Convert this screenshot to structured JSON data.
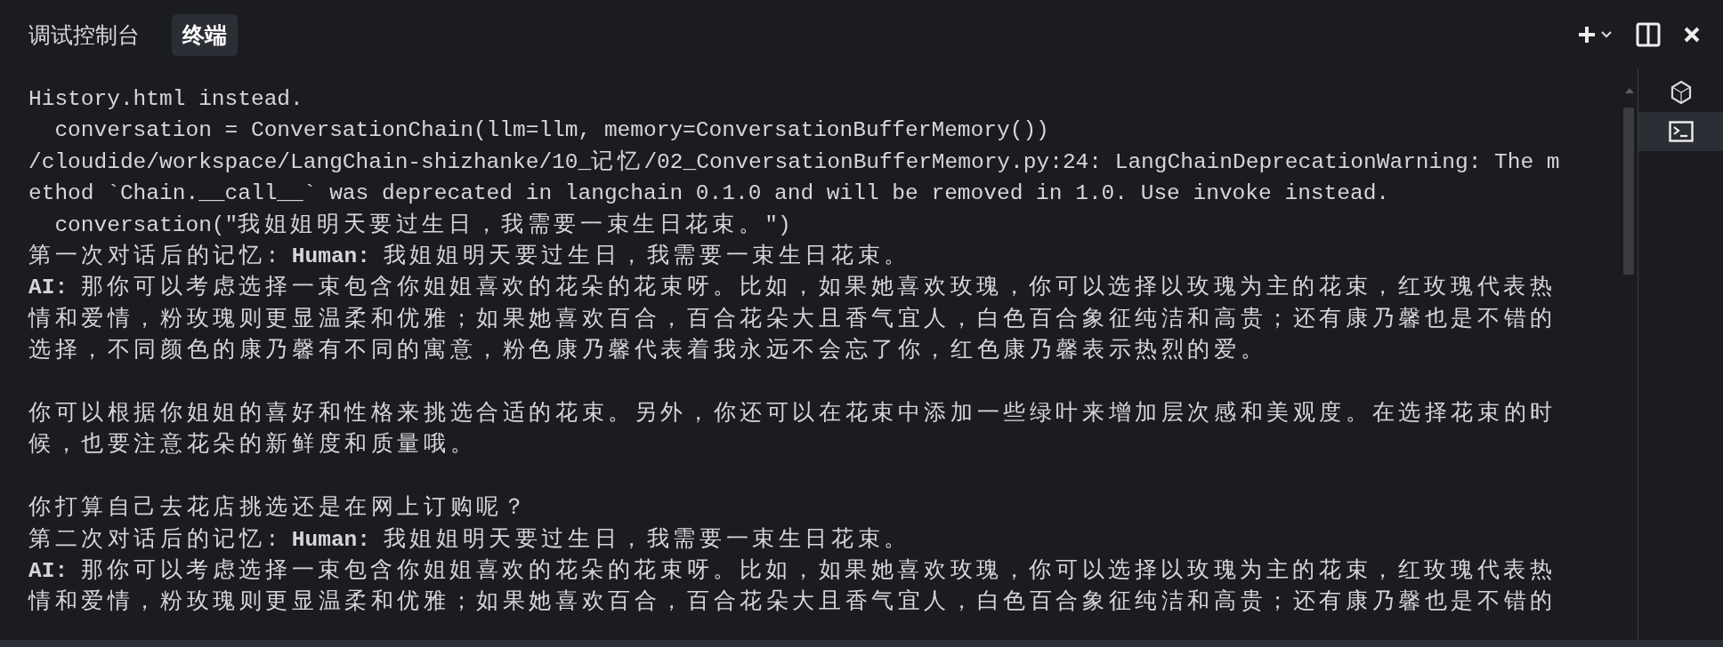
{
  "tabs": [
    {
      "label": "调试控制台",
      "selected": false
    },
    {
      "label": "终端",
      "selected": true
    }
  ],
  "side_tabs": [
    {
      "kind": "shell",
      "selected": false
    },
    {
      "kind": "terminal",
      "selected": true
    }
  ],
  "terminal_lines": [
    {
      "kind": "text",
      "text": "History.html instead."
    },
    {
      "kind": "text",
      "text": "  conversation = ConversationChain(llm=llm, memory=ConversationBufferMemory())"
    },
    {
      "kind": "text",
      "text": "/cloudide/workspace/LangChain-shizhanke/10_记忆/02_ConversationBufferMemory.py:24: LangChainDeprecationWarning: The m"
    },
    {
      "kind": "text",
      "text": "ethod `Chain.__call__` was deprecated in langchain 0.1.0 and will be removed in 1.0. Use invoke instead."
    },
    {
      "kind": "text",
      "text": "  conversation(\"我姐姐明天要过生日，我需要一束生日花束。\")"
    },
    {
      "kind": "text",
      "text": "第一次对话后的记忆: **Human:** 我姐姐明天要过生日，我需要一束生日花束。"
    },
    {
      "kind": "text",
      "text": "**AI:** 那你可以考虑选择一束包含你姐姐喜欢的花朵的花束呀。比如，如果她喜欢玫瑰，你可以选择以玫瑰为主的花束，红玫瑰代表热"
    },
    {
      "kind": "text",
      "text": "情和爱情，粉玫瑰则更显温柔和优雅；如果她喜欢百合，百合花朵大且香气宜人，白色百合象征纯洁和高贵；还有康乃馨也是不错的"
    },
    {
      "kind": "text",
      "text": "选择，不同颜色的康乃馨有不同的寓意，粉色康乃馨代表着我永远不会忘了你，红色康乃馨表示热烈的爱。"
    },
    {
      "kind": "blank"
    },
    {
      "kind": "text",
      "text": "你可以根据你姐姐的喜好和性格来挑选合适的花束。另外，你还可以在花束中添加一些绿叶来增加层次感和美观度。在选择花束的时"
    },
    {
      "kind": "text",
      "text": "候，也要注意花朵的新鲜度和质量哦。"
    },
    {
      "kind": "blank"
    },
    {
      "kind": "text",
      "text": "你打算自己去花店挑选还是在网上订购呢？"
    },
    {
      "kind": "text",
      "text": "第二次对话后的记忆: **Human:** 我姐姐明天要过生日，我需要一束生日花束。"
    },
    {
      "kind": "text",
      "text": "**AI:** 那你可以考虑选择一束包含你姐姐喜欢的花朵的花束呀。比如，如果她喜欢玫瑰，你可以选择以玫瑰为主的花束，红玫瑰代表热"
    },
    {
      "kind": "text",
      "text": "情和爱情，粉玫瑰则更显温柔和优雅；如果她喜欢百合，百合花朵大且香气宜人，白色百合象征纯洁和高贵；还有康乃馨也是不错的"
    }
  ]
}
